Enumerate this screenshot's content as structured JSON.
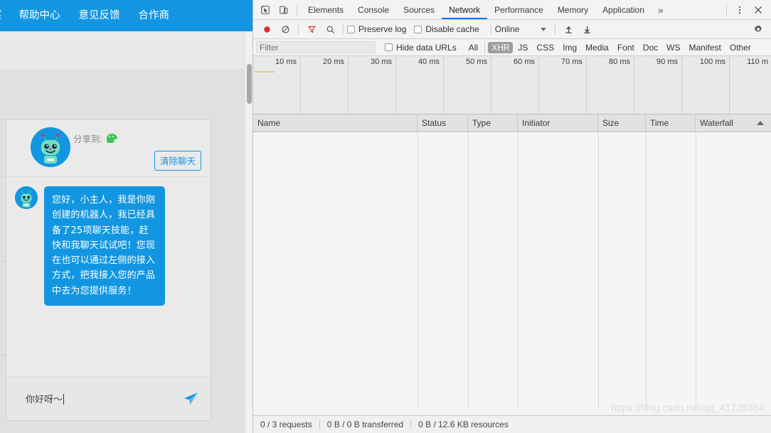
{
  "webpage": {
    "nav": {
      "items": [
        {
          "label": "买"
        },
        {
          "label": "帮助中心"
        },
        {
          "label": "意见反馈"
        },
        {
          "label": "合作商"
        }
      ]
    },
    "chat": {
      "share_label": "分享到:",
      "wechat_icon": "wechat-icon",
      "clear_button": "清除聊天",
      "bot_avatar_icon": "robot-avatar-icon",
      "messages": [
        {
          "sender": "bot",
          "text": "您好，小主人，我是你刚创建的机器人，我已经具备了25项聊天技能，赶快和我聊天试试吧！您现在也可以通过左侧的接入方式，把我接入您的产品中去为您提供服务！"
        }
      ],
      "input_value": "你好呀〜",
      "send_icon": "send-paper-plane-icon"
    },
    "colors": {
      "brand_blue": "#1296e1",
      "page_grey": "#e0e0e0"
    }
  },
  "devtools": {
    "tabbar": {
      "inspect_icon": "inspect-element-icon",
      "device_icon": "toggle-device-toolbar-icon",
      "tabs": [
        {
          "label": "Elements",
          "active": false
        },
        {
          "label": "Console",
          "active": false
        },
        {
          "label": "Sources",
          "active": false
        },
        {
          "label": "Network",
          "active": true
        },
        {
          "label": "Performance",
          "active": false
        },
        {
          "label": "Memory",
          "active": false
        },
        {
          "label": "Application",
          "active": false
        }
      ],
      "more_label": "»",
      "menu_icon": "kebab-menu-icon",
      "close_icon": "close-icon"
    },
    "toolbar": {
      "record_icon": "record-button-icon",
      "clear_icon": "clear-network-log-icon",
      "filter_icon": "filter-funnel-icon",
      "search_icon": "search-icon",
      "preserve_log_label": "Preserve log",
      "preserve_log_checked": false,
      "disable_cache_label": "Disable cache",
      "disable_cache_checked": false,
      "throttle_value": "Online",
      "import_icon": "import-har-icon",
      "export_icon": "export-har-icon",
      "settings_icon": "gear-icon"
    },
    "filterbar": {
      "filter_placeholder": "Filter",
      "filter_value": "",
      "hide_data_urls_label": "Hide data URLs",
      "hide_data_urls_checked": false,
      "types": [
        {
          "label": "All",
          "selected": false
        },
        {
          "label": "XHR",
          "selected": true
        },
        {
          "label": "JS",
          "selected": false
        },
        {
          "label": "CSS",
          "selected": false
        },
        {
          "label": "Img",
          "selected": false
        },
        {
          "label": "Media",
          "selected": false
        },
        {
          "label": "Font",
          "selected": false
        },
        {
          "label": "Doc",
          "selected": false
        },
        {
          "label": "WS",
          "selected": false
        },
        {
          "label": "Manifest",
          "selected": false
        },
        {
          "label": "Other",
          "selected": false
        }
      ]
    },
    "overview": {
      "ticks": [
        "10 ms",
        "20 ms",
        "30 ms",
        "40 ms",
        "50 ms",
        "60 ms",
        "70 ms",
        "80 ms",
        "90 ms",
        "100 ms",
        "110 m"
      ]
    },
    "table": {
      "columns": [
        {
          "label": "Name"
        },
        {
          "label": "Status"
        },
        {
          "label": "Type"
        },
        {
          "label": "Initiator"
        },
        {
          "label": "Size"
        },
        {
          "label": "Time"
        },
        {
          "label": "Waterfall"
        }
      ],
      "sort_indicator": "sort-ascending-icon",
      "rows": []
    },
    "status": {
      "requests": "0 / 3 requests",
      "transferred": "0 B / 0 B transferred",
      "resources": "0 B / 12.6 KB resources"
    }
  },
  "watermark": "https://blog.csdn.net/qq_41739364"
}
